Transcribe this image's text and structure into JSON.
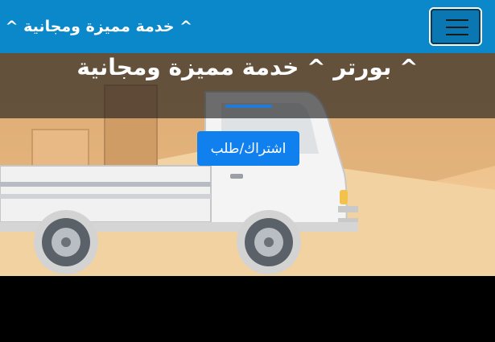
{
  "navbar": {
    "brand": "^ خدمة مميزة ومجانية ^",
    "menu_icon": "hamburger-menu-icon",
    "background": "#0b88c9"
  },
  "hero": {
    "title": "^ بورتر ^ خدمة مميزة ومجانية",
    "cta_label": "اشتراك/طلب",
    "accent_color": "#1f7bd8",
    "cta_color": "#1080ef",
    "image": "white-pickup-truck-illustration"
  }
}
